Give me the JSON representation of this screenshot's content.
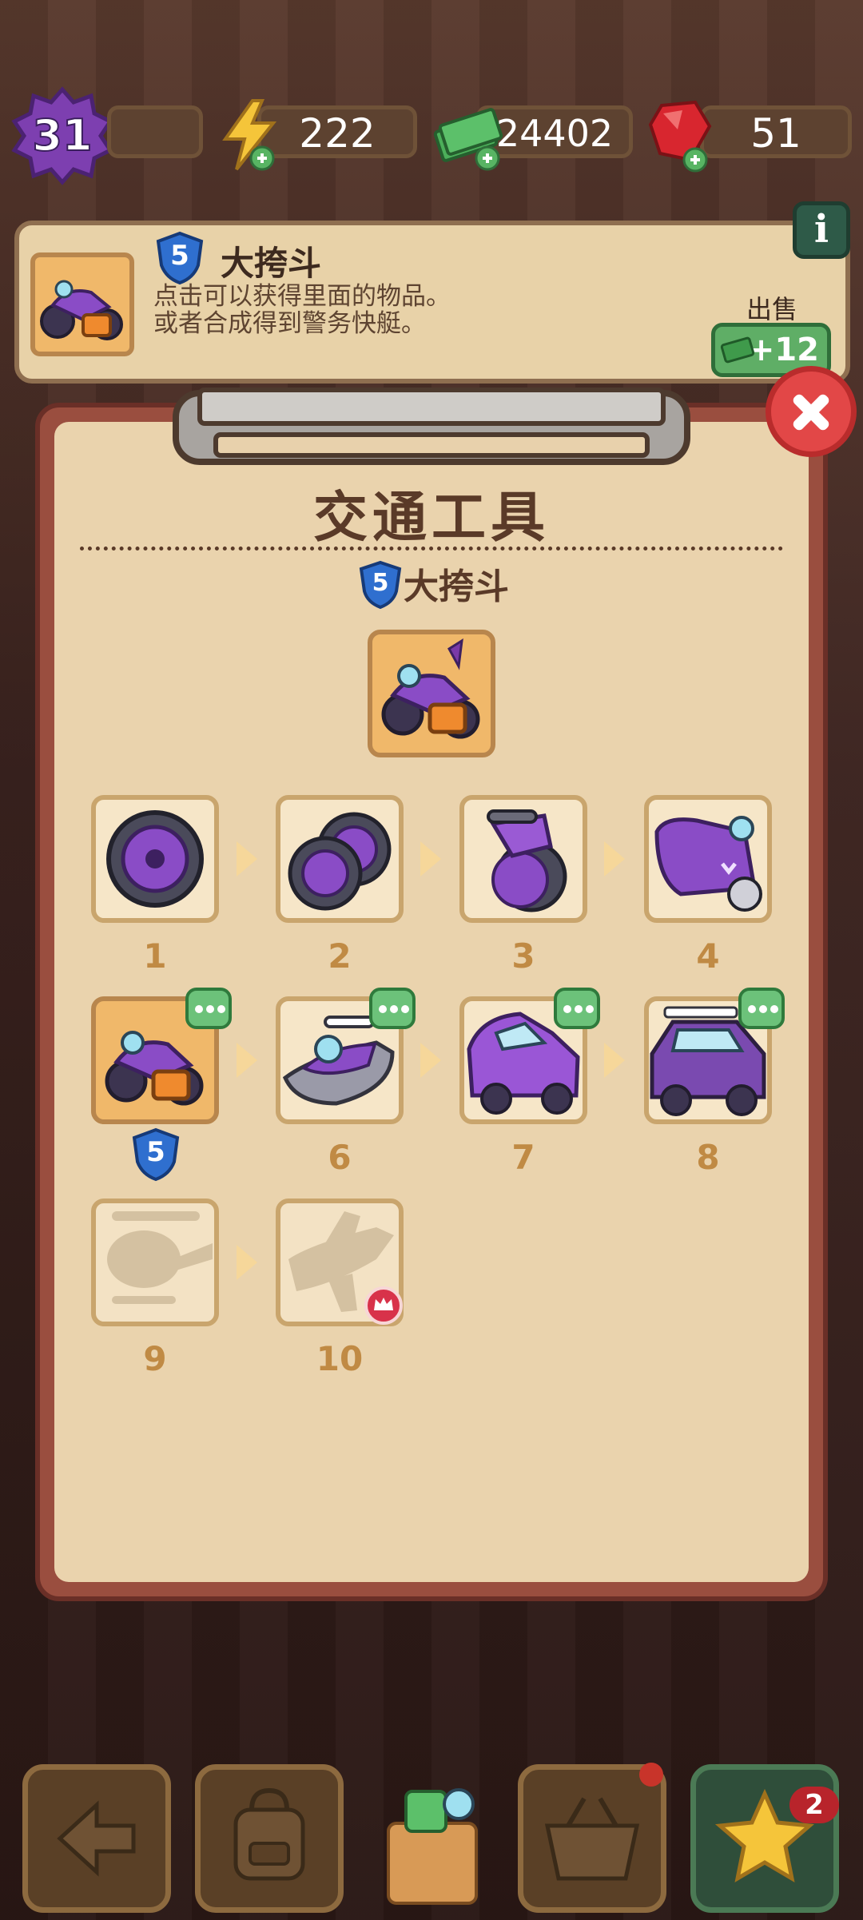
{
  "header": {
    "level": "31",
    "energy": "222",
    "cash": "24402",
    "gems": "51"
  },
  "info_card": {
    "level_badge": "5",
    "title": "大挎斗",
    "description_line1": "点击可以获得里面的物品。",
    "description_line2": "或者合成得到警务快艇。",
    "sell_label": "出售",
    "sell_value": "+12",
    "info_button": "i"
  },
  "dialog": {
    "title": "交通工具",
    "subtitle": "大挎斗",
    "subtitle_level": "5",
    "items": [
      {
        "num": "1",
        "icon": "purple-wheel-icon",
        "selected": false,
        "has_more": false
      },
      {
        "num": "2",
        "icon": "two-wheels-icon",
        "selected": false,
        "has_more": false
      },
      {
        "num": "3",
        "icon": "folding-bike-icon",
        "selected": false,
        "has_more": false
      },
      {
        "num": "4",
        "icon": "scooter-icon",
        "selected": false,
        "has_more": false
      },
      {
        "num": "5",
        "icon": "sidecar-motorbike-icon",
        "selected": true,
        "has_more": true,
        "level": "5"
      },
      {
        "num": "6",
        "icon": "jet-ski-icon",
        "selected": false,
        "has_more": true
      },
      {
        "num": "7",
        "icon": "purple-car-icon",
        "selected": false,
        "has_more": true
      },
      {
        "num": "8",
        "icon": "offroad-jeep-icon",
        "selected": false,
        "has_more": true
      },
      {
        "num": "9",
        "icon": "helicopter-silhouette-icon",
        "selected": false,
        "locked": true
      },
      {
        "num": "10",
        "icon": "airplane-silhouette-icon",
        "selected": false,
        "locked": true,
        "crown": true
      }
    ]
  },
  "bottom_bar": {
    "star_badge": "2"
  },
  "colors": {
    "accent_orange": "#f0b86a",
    "tile_border": "#c9a56d",
    "number_color": "#c08a44",
    "close_red": "#e24747",
    "badge_green": "#6cc27a"
  }
}
